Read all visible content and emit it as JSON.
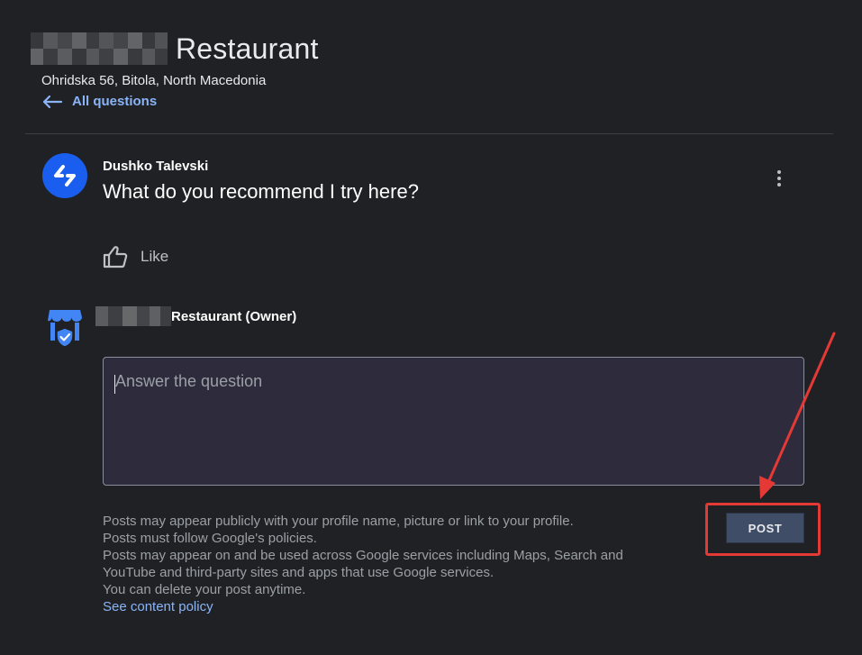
{
  "header": {
    "title": "Restaurant",
    "address": "Ohridska 56, Bitola, North Macedonia",
    "back_link": "All questions"
  },
  "question": {
    "author": "Dushko Talevski",
    "text": "What do you recommend I try here?",
    "like_label": "Like"
  },
  "owner": {
    "name": "Restaurant (Owner)"
  },
  "answer": {
    "placeholder": "Answer the question"
  },
  "post_button": {
    "label": "POST"
  },
  "policies": {
    "lines": [
      "Posts may appear publicly with your profile name, picture or link to your profile.",
      "Posts must follow Google's policies.",
      "Posts may appear on and be used across Google services including Maps, Search and",
      "YouTube and third-party sites and apps that use Google services.",
      "You can delete your post anytime."
    ],
    "link": "See content policy"
  },
  "colors": {
    "background": "#202124",
    "link": "#8ab4f8",
    "avatar": "#1a5ef0",
    "owner_icon": "#4285f4",
    "annotation": "#e53935",
    "post_button": "#3f4d66"
  }
}
